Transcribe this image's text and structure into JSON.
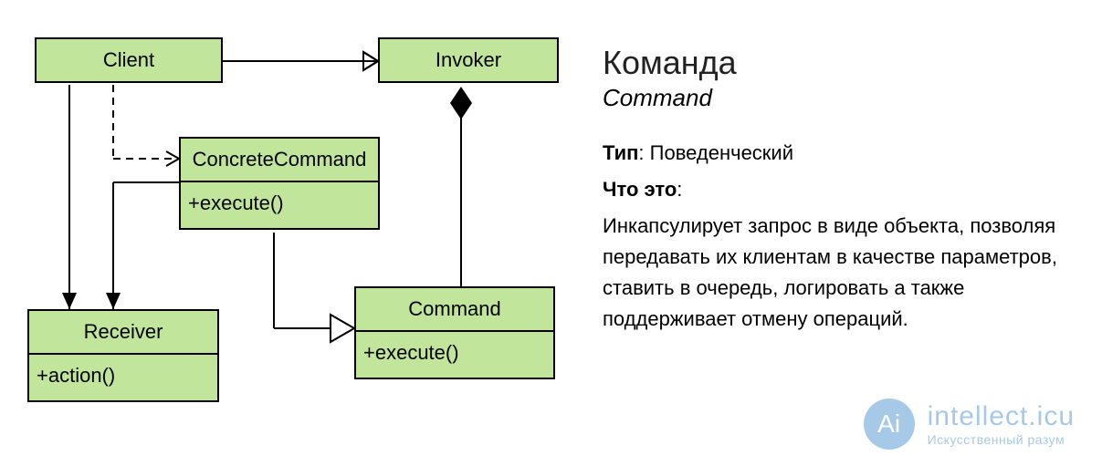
{
  "diagram": {
    "boxes": {
      "client": {
        "title": "Client"
      },
      "invoker": {
        "title": "Invoker"
      },
      "concreteCommand": {
        "title": "ConcreteCommand",
        "method": "+execute()"
      },
      "receiver": {
        "title": "Receiver",
        "method": "+action()"
      },
      "command": {
        "title": "Command",
        "method": "+execute()"
      }
    }
  },
  "description": {
    "title": "Команда",
    "subtitle": "Command",
    "typeLabel": "Тип",
    "typeValue": ": Поведенческий",
    "whatLabel": "Что это",
    "whatColon": ":",
    "body": "Инкапсулирует запрос в виде объекта, позволяя передавать их клиентам в качестве параметров, ставить в очередь, логировать а также поддерживает отме­ну операций."
  },
  "watermark": {
    "badge": "Ai",
    "line1": "intellect.icu",
    "line2": "Искусственный разум"
  }
}
